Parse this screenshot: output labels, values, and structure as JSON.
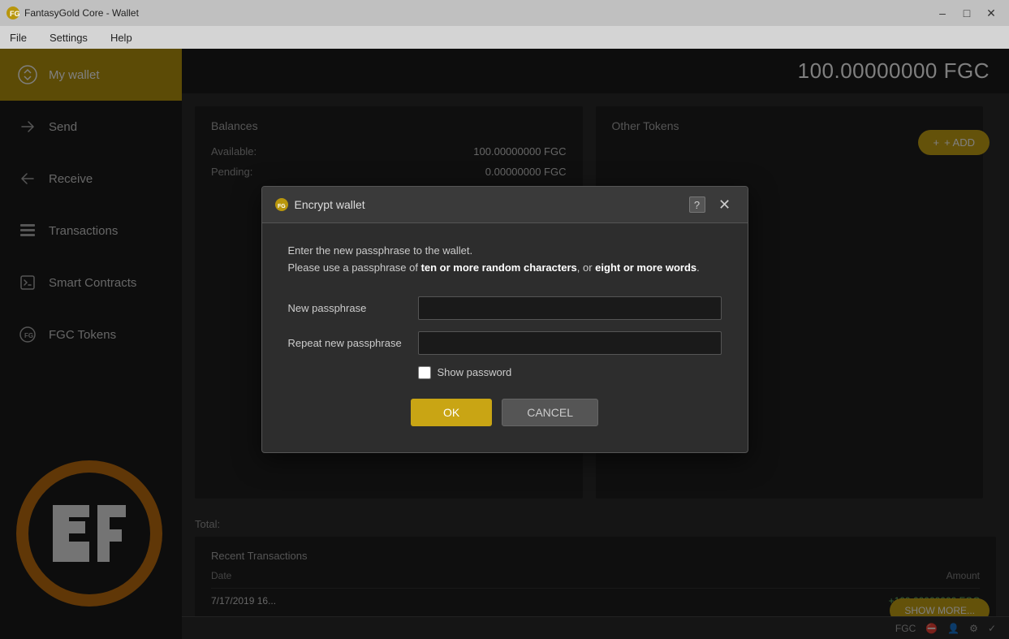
{
  "titlebar": {
    "title": "FantasyGold Core - Wallet",
    "icon": "FG"
  },
  "menubar": {
    "items": [
      "File",
      "Settings",
      "Help"
    ]
  },
  "balance_display": "100.00000000 FGC",
  "sidebar": {
    "items": [
      {
        "id": "wallet",
        "label": "My wallet",
        "active": true
      },
      {
        "id": "send",
        "label": "Send",
        "active": false
      },
      {
        "id": "receive",
        "label": "Receive",
        "active": false
      },
      {
        "id": "transactions",
        "label": "Transactions",
        "active": false
      },
      {
        "id": "smart-contracts",
        "label": "Smart Contracts",
        "active": false
      },
      {
        "id": "fgc-tokens",
        "label": "FGC Tokens",
        "active": false
      }
    ]
  },
  "balances": {
    "header": "Balances",
    "available_label": "Available:",
    "available_value": "100.00000000 FGC",
    "pending_label": "Pending:",
    "pending_value": "0.00000000 FGC",
    "total_label": "Total:",
    "total_value": ""
  },
  "other_tokens": {
    "header": "Other Tokens"
  },
  "add_button": "+ ADD",
  "recent_transactions": {
    "header": "Recent Transactions",
    "date_col": "Date",
    "amount_col": "Amount",
    "rows": [
      {
        "date": "7/17/2019 16...",
        "amount": "+100.00000000 FGC"
      }
    ]
  },
  "show_more_btn": "SHOW MORE...",
  "modal": {
    "title": "Encrypt wallet",
    "info_line1": "Enter the new passphrase to the wallet.",
    "info_line2_before": "Please use a passphrase of ",
    "info_bold1": "ten or more random characters",
    "info_line2_mid": ", or ",
    "info_bold2": "eight or more words",
    "info_line2_end": ".",
    "new_passphrase_label": "New passphrase",
    "repeat_passphrase_label": "Repeat new passphrase",
    "show_password_label": "Show password",
    "ok_label": "OK",
    "cancel_label": "CANCEL"
  },
  "statusbar": {
    "unit": "FGC",
    "icons": [
      "minus-circle",
      "user-circle",
      "network",
      "checkmark"
    ]
  }
}
